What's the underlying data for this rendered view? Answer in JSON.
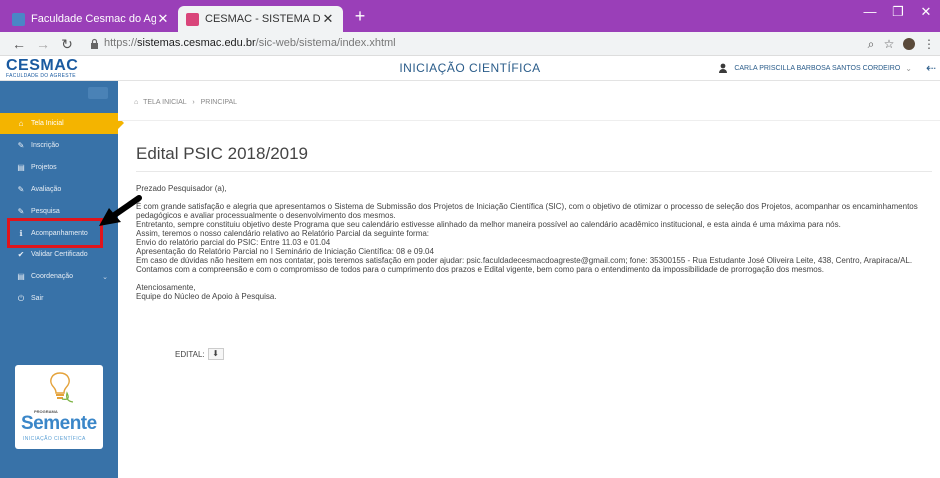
{
  "browser": {
    "tabs": [
      {
        "label": "Faculdade Cesmac do Agreste",
        "active": false
      },
      {
        "label": "CESMAC - SISTEMA DE INICIAÇÃ",
        "active": true
      }
    ],
    "new_tab": "+",
    "url_scheme": "https://",
    "url_host": "sistemas.cesmac.edu.br",
    "url_path": "/sic-web/sistema/index.xhtml"
  },
  "header": {
    "logo_text": "CESMAC",
    "logo_sub": "FACULDADE DO AGRESTE",
    "title": "INICIAÇÃO CIENTÍFICA",
    "user_name": "CARLA PRISCILLA BARBOSA SANTOS CORDEIRO"
  },
  "sidebar": {
    "items": [
      {
        "label": "Tela Inicial",
        "icon": "home-icon",
        "glyph": "⌂",
        "active": true
      },
      {
        "label": "Inscrição",
        "icon": "edit-icon",
        "glyph": "✎",
        "active": false
      },
      {
        "label": "Projetos",
        "icon": "list-icon",
        "glyph": "▤",
        "active": false
      },
      {
        "label": "Avaliação",
        "icon": "edit-icon",
        "glyph": "✎",
        "active": false
      },
      {
        "label": "Pesquisa",
        "icon": "edit-icon",
        "glyph": "✎",
        "active": false
      },
      {
        "label": "Acompanhamento",
        "icon": "info-icon",
        "glyph": "ℹ",
        "active": false
      },
      {
        "label": "Validar Certificado",
        "icon": "check-icon",
        "glyph": "✔",
        "active": false
      },
      {
        "label": "Coordenação",
        "icon": "list-icon",
        "glyph": "▤",
        "active": false
      },
      {
        "label": "Sair",
        "icon": "power-icon",
        "glyph": "⏻",
        "active": false
      }
    ],
    "promo": {
      "program": "PROGRAMA",
      "word": "Semente",
      "sub": "INICIAÇÃO CIENTÍFICA"
    }
  },
  "breadcrumb": {
    "home": "TELA INICIAL",
    "current": "PRINCIPAL"
  },
  "main": {
    "title": "Edital PSIC 2018/2019",
    "greeting": "Prezado Pesquisador (a),",
    "paragraphs": [
      "É com grande satisfação e alegria que apresentamos o Sistema de Submissão dos Projetos de Iniciação Científica (SIC), com o objetivo de otimizar o processo de seleção dos Projetos, acompanhar os encaminhamentos pedagógicos e avaliar processualmente o desenvolvimento dos mesmos.",
      "Entretanto, sempre constituiu objetivo deste Programa que seu calendário estivesse alinhado da melhor maneira possível ao calendário acadêmico institucional, e esta ainda é uma máxima para nós.",
      "Assim, teremos o nosso calendário relativo ao Relatório Parcial da seguinte forma:",
      "Envio do relatório parcial do PSIC: Entre 11.03 e 01.04",
      "Apresentação do Relatório Parcial no I Seminário de Iniciação Científica: 08 e 09.04",
      "Em caso de dúvidas não hesitem em nos contatar, pois teremos satisfação em poder ajudar: psic.faculdadecesmacdoagreste@gmail.com; fone: 35300155 - Rua Estudante José Oliveira Leite, 438, Centro, Arapiraca/AL.",
      "Contamos com a compreensão e com o compromisso de todos para o cumprimento dos prazos e Edital vigente, bem como para o entendimento da impossibilidade de prorrogação dos mesmos."
    ],
    "closing_1": "Atenciosamente,",
    "closing_2": "Equipe do Núcleo de Apoio à Pesquisa.",
    "edital_label": "EDITAL:",
    "download_glyph": "⬇"
  },
  "colors": {
    "tabbar": "#9a3fb8",
    "sidebar": "#3872a8",
    "active_item": "#f4b400",
    "highlight": "#e0141b",
    "brand": "#1a5aa0"
  }
}
